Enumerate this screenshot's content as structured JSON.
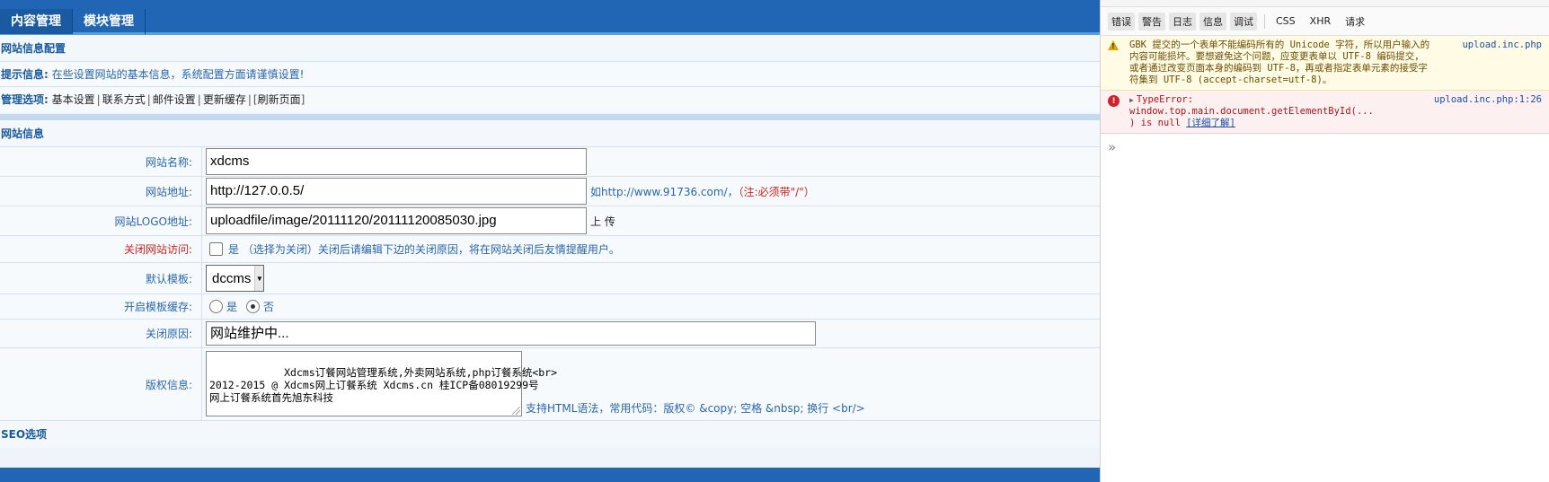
{
  "nav": {
    "tabs": [
      "内容管理",
      "模块管理"
    ]
  },
  "config": {
    "title": "网站信息配置",
    "hint_label": "提示信息:",
    "hint_text": "在些设置网站的基本信息，系统配置方面请谨慎设置!",
    "manage_label": "管理选项:",
    "manage_links": [
      "基本设置",
      "联系方式",
      "邮件设置",
      "更新缓存",
      "刷新页面"
    ]
  },
  "site_info": {
    "title": "网站信息",
    "name_label": "网站名称:",
    "name_value": "xdcms",
    "url_label": "网站地址:",
    "url_value": "http://127.0.0.5/",
    "url_hint": "如http://www.91736.com/，",
    "url_hint_red": "（注:必须带\"/\"）",
    "logo_label": "网站LOGO地址:",
    "logo_value": "uploadfile/image/20111120/20111120085030.jpg",
    "logo_upload": "上 传",
    "close_label": "关闭网站访问:",
    "close_hint": "是 （选择为关闭）关闭后请编辑下边的关闭原因，将在网站关闭后友情提醒用户。",
    "template_label": "默认模板:",
    "template_value": "dccms",
    "cache_label": "开启模板缓存:",
    "cache_yes": "是",
    "cache_no": "否",
    "reason_label": "关闭原因:",
    "reason_value": "网站维护中...",
    "copyright_label": "版权信息:",
    "copyright_value": "Xdcms订餐网站管理系统,外卖网站系统,php订餐系统<br>\n2012-2015 @ Xdcms网上订餐系统 Xdcms.cn 桂ICP备08019299号\n网上订餐系统首先旭东科技",
    "copyright_hint": "支持HTML语法，常用代码：版权© &copy; 空格 &nbsp; 换行 <br/>",
    "seo_title": "SEO选项"
  },
  "devtools": {
    "filters": [
      "错误",
      "警告",
      "日志",
      "信息",
      "调试"
    ],
    "types": [
      "CSS",
      "XHR",
      "请求"
    ],
    "warning": {
      "text": "GBK 提交的一个表单不能编码所有的 Unicode 字符，所以用户输入的\n内容可能损坏。要想避免这个问题，应变更表单以 UTF-8 编码提交，\n或者通过改变页面本身的编码到 UTF-8，再或者指定表单元素的接受字\n符集到 UTF-8 (accept-charset=utf-8)。",
      "source": "upload.inc.php"
    },
    "error": {
      "line1": "TypeError:",
      "line2": "window.top.main.document.getElementById(...",
      "line3": ") is null",
      "learn_more": "[详细了解]",
      "source": "upload.inc.php:1:26"
    },
    "prompt": "»"
  }
}
